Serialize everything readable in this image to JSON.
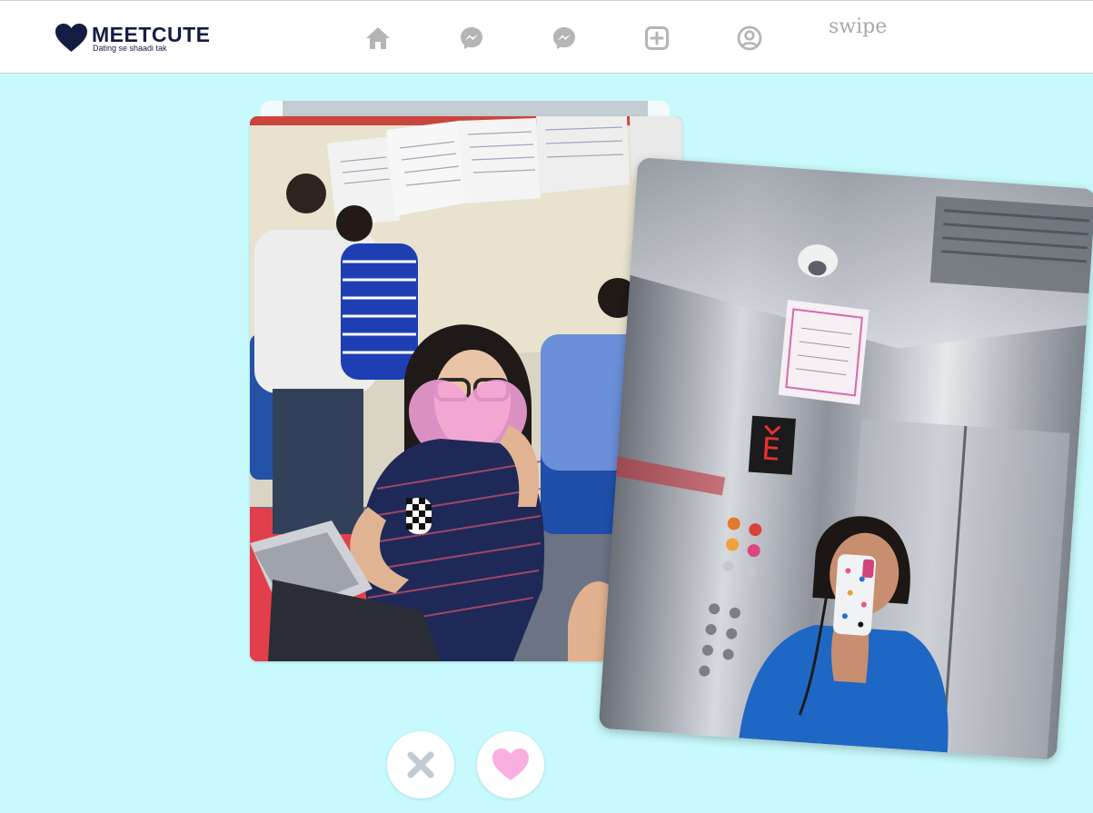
{
  "brand": {
    "name": "MEETCUTE",
    "tagline": "Dating se shaadi tak",
    "color": "#141c44"
  },
  "nav": {
    "items": [
      {
        "icon": "home-icon"
      },
      {
        "icon": "messenger-icon"
      },
      {
        "icon": "messenger-icon"
      },
      {
        "icon": "add-square-icon"
      },
      {
        "icon": "profile-circle-icon"
      }
    ],
    "swipe_label": "swipe",
    "icon_color": "#b5b5b5"
  },
  "cards": {
    "front": {
      "subject": "classroom-photo"
    },
    "swiping": {
      "subject": "elevator-selfie-photo"
    }
  },
  "actions": {
    "dislike": {
      "icon": "close-icon",
      "color": "#c2cbd3"
    },
    "like": {
      "icon": "heart-icon",
      "color": "#f9aee2"
    }
  },
  "colors": {
    "background": "#c8fafd",
    "topbar": "#ffffff"
  }
}
